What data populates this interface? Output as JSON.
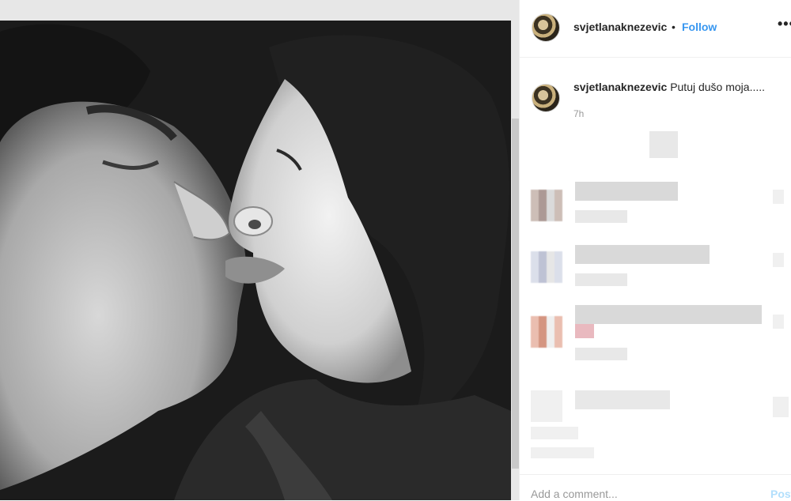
{
  "post": {
    "username": "svjetlanaknezevic",
    "separator": "•",
    "follow_label": "Follow",
    "more_label": "•••",
    "caption": "Putuj dušo moja.....",
    "time": "7h"
  },
  "composer": {
    "placeholder": "Add a comment...",
    "post_label": "Post"
  },
  "colors": {
    "follow_blue": "#3897f0",
    "muted_text": "#999999",
    "border": "#efefef"
  }
}
